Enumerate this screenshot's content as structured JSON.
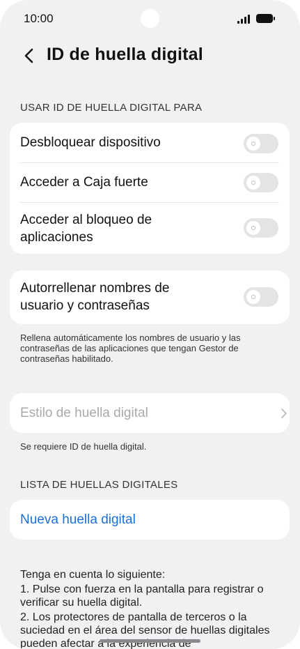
{
  "status_bar": {
    "time": "10:00"
  },
  "header": {
    "title": "ID de huella digital"
  },
  "section_use": {
    "title": "USAR ID DE HUELLA DIGITAL PARA",
    "items": [
      {
        "label": "Desbloquear dispositivo",
        "enabled": false
      },
      {
        "label": "Acceder a Caja fuerte",
        "enabled": false
      },
      {
        "label": "Acceder al bloqueo de aplicaciones",
        "enabled": false
      }
    ]
  },
  "autofill": {
    "label": "Autorrellenar nombres de usuario y contraseñas",
    "enabled": false,
    "description": "Rellena automáticamente los nombres de usuario y las contraseñas de las aplicaciones que tengan Gestor de contraseñas habilitado."
  },
  "style": {
    "label": "Estilo de huella digital",
    "note": "Se requiere ID de huella digital."
  },
  "section_list": {
    "title": "LISTA DE HUELLAS DIGITALES",
    "new_label": "Nueva huella digital"
  },
  "notes": {
    "heading": "Tenga en cuenta lo siguiente:",
    "items": [
      "1. Pulse con fuerza en la pantalla para registrar o verificar su huella digital.",
      "2. Los protectores de pantalla de terceros o la suciedad en el área del sensor de huellas digitales pueden afectar a la experiencia de"
    ]
  },
  "colors": {
    "accent": "#1a6fd9",
    "background": "#f1f1f3",
    "card": "#ffffff"
  }
}
